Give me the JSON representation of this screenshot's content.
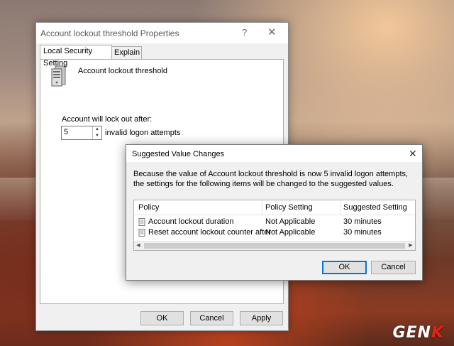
{
  "props_window": {
    "title": "Account lockout threshold Properties",
    "help_glyph": "?",
    "close_glyph": "✕",
    "tabs": [
      {
        "label": "Local Security Setting",
        "active": true
      },
      {
        "label": "Explain",
        "active": false
      }
    ],
    "policy_name": "Account lockout threshold",
    "icon": "server-icon",
    "lock_label": "Account will lock out after:",
    "attempts_value": "5",
    "unit_label": "invalid logon attempts",
    "buttons": {
      "ok": "OK",
      "cancel": "Cancel",
      "apply": "Apply"
    }
  },
  "dialog": {
    "title": "Suggested Value Changes",
    "close_glyph": "✕",
    "message": "Because the value of Account lockout threshold is now 5 invalid logon attempts, the settings for the following items will be changed to the suggested values.",
    "columns": [
      "Policy",
      "Policy Setting",
      "Suggested Setting"
    ],
    "rows": [
      {
        "policy": "Account lockout duration",
        "setting": "Not Applicable",
        "suggested": "30 minutes"
      },
      {
        "policy": "Reset account lockout counter after",
        "setting": "Not Applicable",
        "suggested": "30 minutes"
      }
    ],
    "buttons": {
      "ok": "OK",
      "cancel": "Cancel"
    }
  },
  "watermark": {
    "text_main": "GEN",
    "text_accent": "K"
  },
  "colors": {
    "accent": "#0078d7",
    "watermark_accent": "#e2231a"
  }
}
